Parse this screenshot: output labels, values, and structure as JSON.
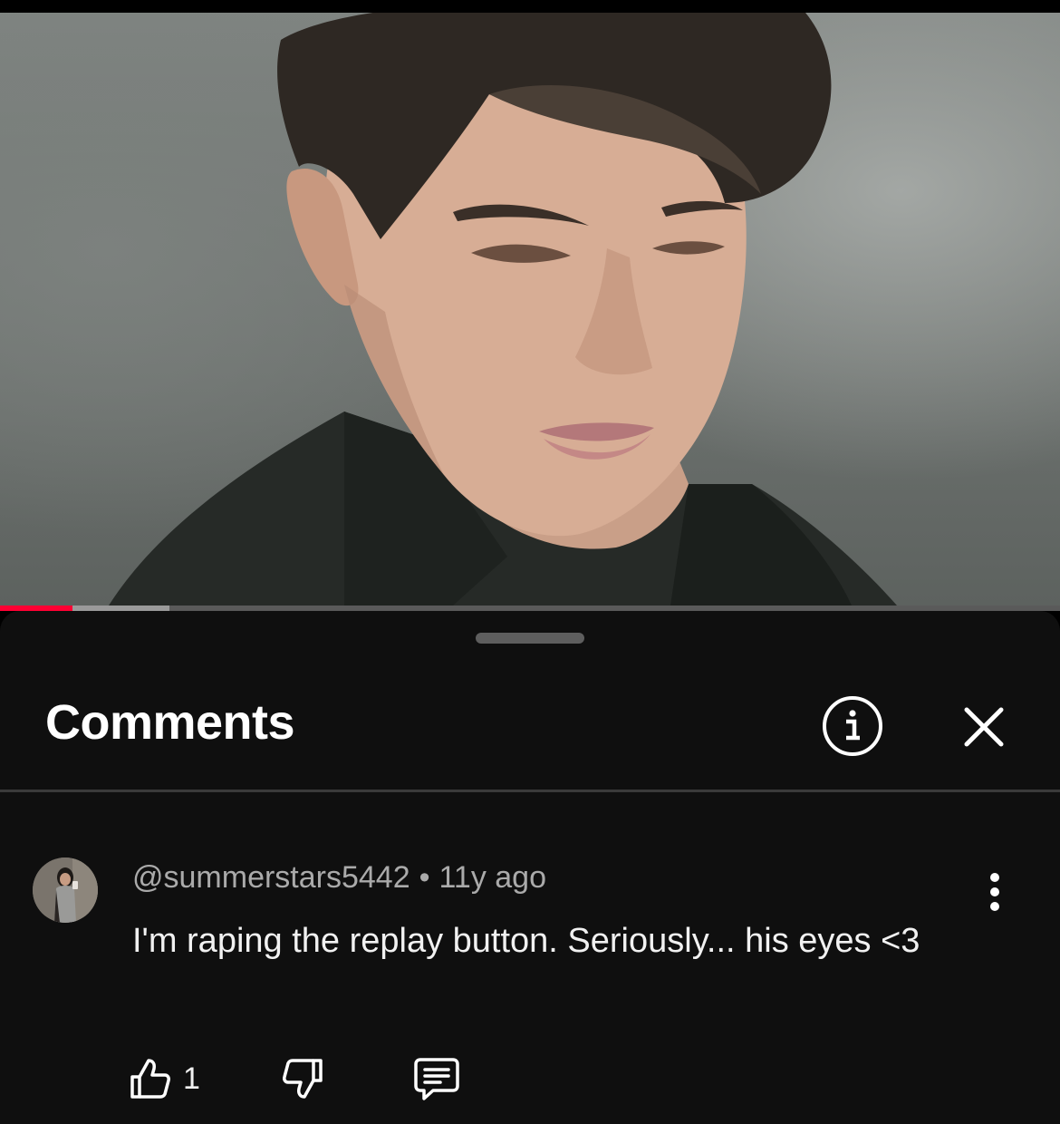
{
  "video": {
    "progress_played": 0.068,
    "progress_buffered": 0.16,
    "colors": {
      "played": "#ff0033",
      "buffer": "#9a9a9a",
      "track": "#5a5a5a"
    }
  },
  "comments_panel": {
    "title": "Comments",
    "info_icon": "info-circle-icon",
    "close_icon": "close-x-icon"
  },
  "comment": {
    "author": "@summerstars5442",
    "separator": "•",
    "time_ago": "11y ago",
    "text": "I'm raping the replay button. Seriously... his eyes <3",
    "like_count": "1",
    "icons": {
      "like": "thumbs-up-icon",
      "dislike": "thumbs-down-icon",
      "reply": "reply-comment-icon",
      "more": "more-vertical-icon"
    }
  }
}
